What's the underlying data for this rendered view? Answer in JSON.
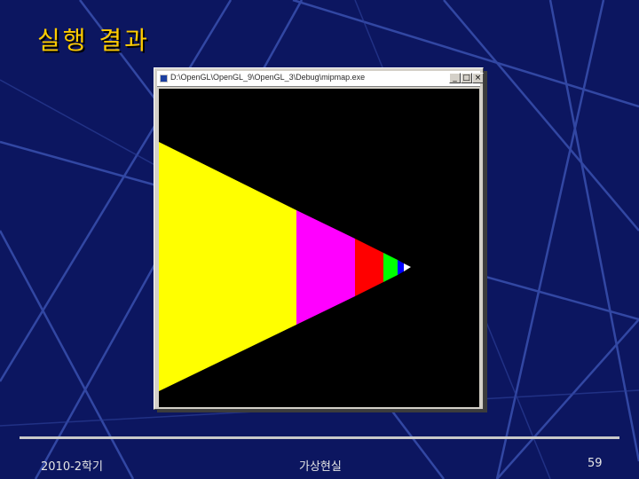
{
  "slide": {
    "title": "실행 결과",
    "footer_left": "2010-2학기",
    "footer_center": "가상현실",
    "footer_right": "59"
  },
  "window": {
    "title": "D:\\OpenGL\\OpenGL_9\\OpenGL_3\\Debug\\mipmap.exe",
    "minimize_label": "_",
    "maximize_label": "□",
    "close_label": "×"
  },
  "render": {
    "background": "#000000",
    "band_colors": [
      "#ffff00",
      "#ff00ff",
      "#ff0000",
      "#00ff00",
      "#0000ff",
      "#ffffff"
    ]
  },
  "theme": {
    "slide_background": "#0c1660",
    "title_color": "#ffcc00"
  }
}
